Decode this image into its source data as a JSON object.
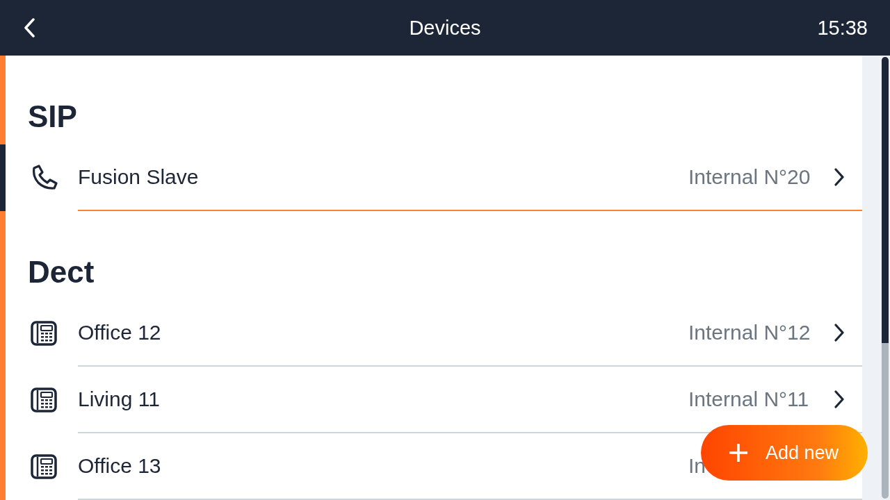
{
  "header": {
    "title": "Devices",
    "time": "15:38"
  },
  "sections": [
    {
      "title": "SIP",
      "rows": [
        {
          "kind": "sip",
          "name": "Fusion Slave",
          "number": "Internal N°20",
          "chevron": true,
          "selected": true
        }
      ]
    },
    {
      "title": "Dect",
      "rows": [
        {
          "kind": "dect",
          "name": "Office 12",
          "number": "Internal N°12",
          "chevron": true,
          "selected": false
        },
        {
          "kind": "dect",
          "name": "Living 11",
          "number": "Internal N°11",
          "chevron": true,
          "selected": false
        },
        {
          "kind": "dect",
          "name": "Office 13",
          "number": "In",
          "chevron": false,
          "selected": false
        }
      ]
    }
  ],
  "add_button": {
    "label": "Add new"
  }
}
